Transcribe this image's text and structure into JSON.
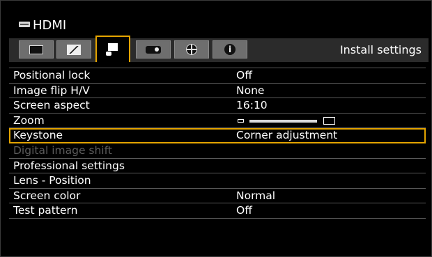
{
  "source": {
    "badge_icon": "hdmi-badge-icon",
    "label": "HDMI"
  },
  "tabs": [
    {
      "id": "image-adjustments",
      "icon": "screen-icon"
    },
    {
      "id": "input-settings",
      "icon": "image-icon"
    },
    {
      "id": "install-settings",
      "icon": "install-icon",
      "active": true
    },
    {
      "id": "system-settings",
      "icon": "projector-icon"
    },
    {
      "id": "network-settings",
      "icon": "network-icon"
    },
    {
      "id": "information",
      "icon": "info-icon"
    }
  ],
  "active_tab_title": "Install settings",
  "accent_color": "#e4a400",
  "menu": {
    "items": [
      {
        "label": "Positional lock",
        "value": "Off"
      },
      {
        "label": "Image flip H/V",
        "value": "None"
      },
      {
        "label": "Screen aspect",
        "value": "16:10"
      },
      {
        "label": "Zoom",
        "value": ""
      },
      {
        "label": "Keystone",
        "value": "Corner adjustment",
        "selected": true
      },
      {
        "label": "Digital image shift",
        "value": "",
        "disabled": true
      },
      {
        "label": "Professional settings",
        "value": ""
      },
      {
        "label": "Lens - Position",
        "value": ""
      },
      {
        "label": "Screen color",
        "value": "Normal"
      },
      {
        "label": "Test pattern",
        "value": "Off"
      }
    ]
  }
}
